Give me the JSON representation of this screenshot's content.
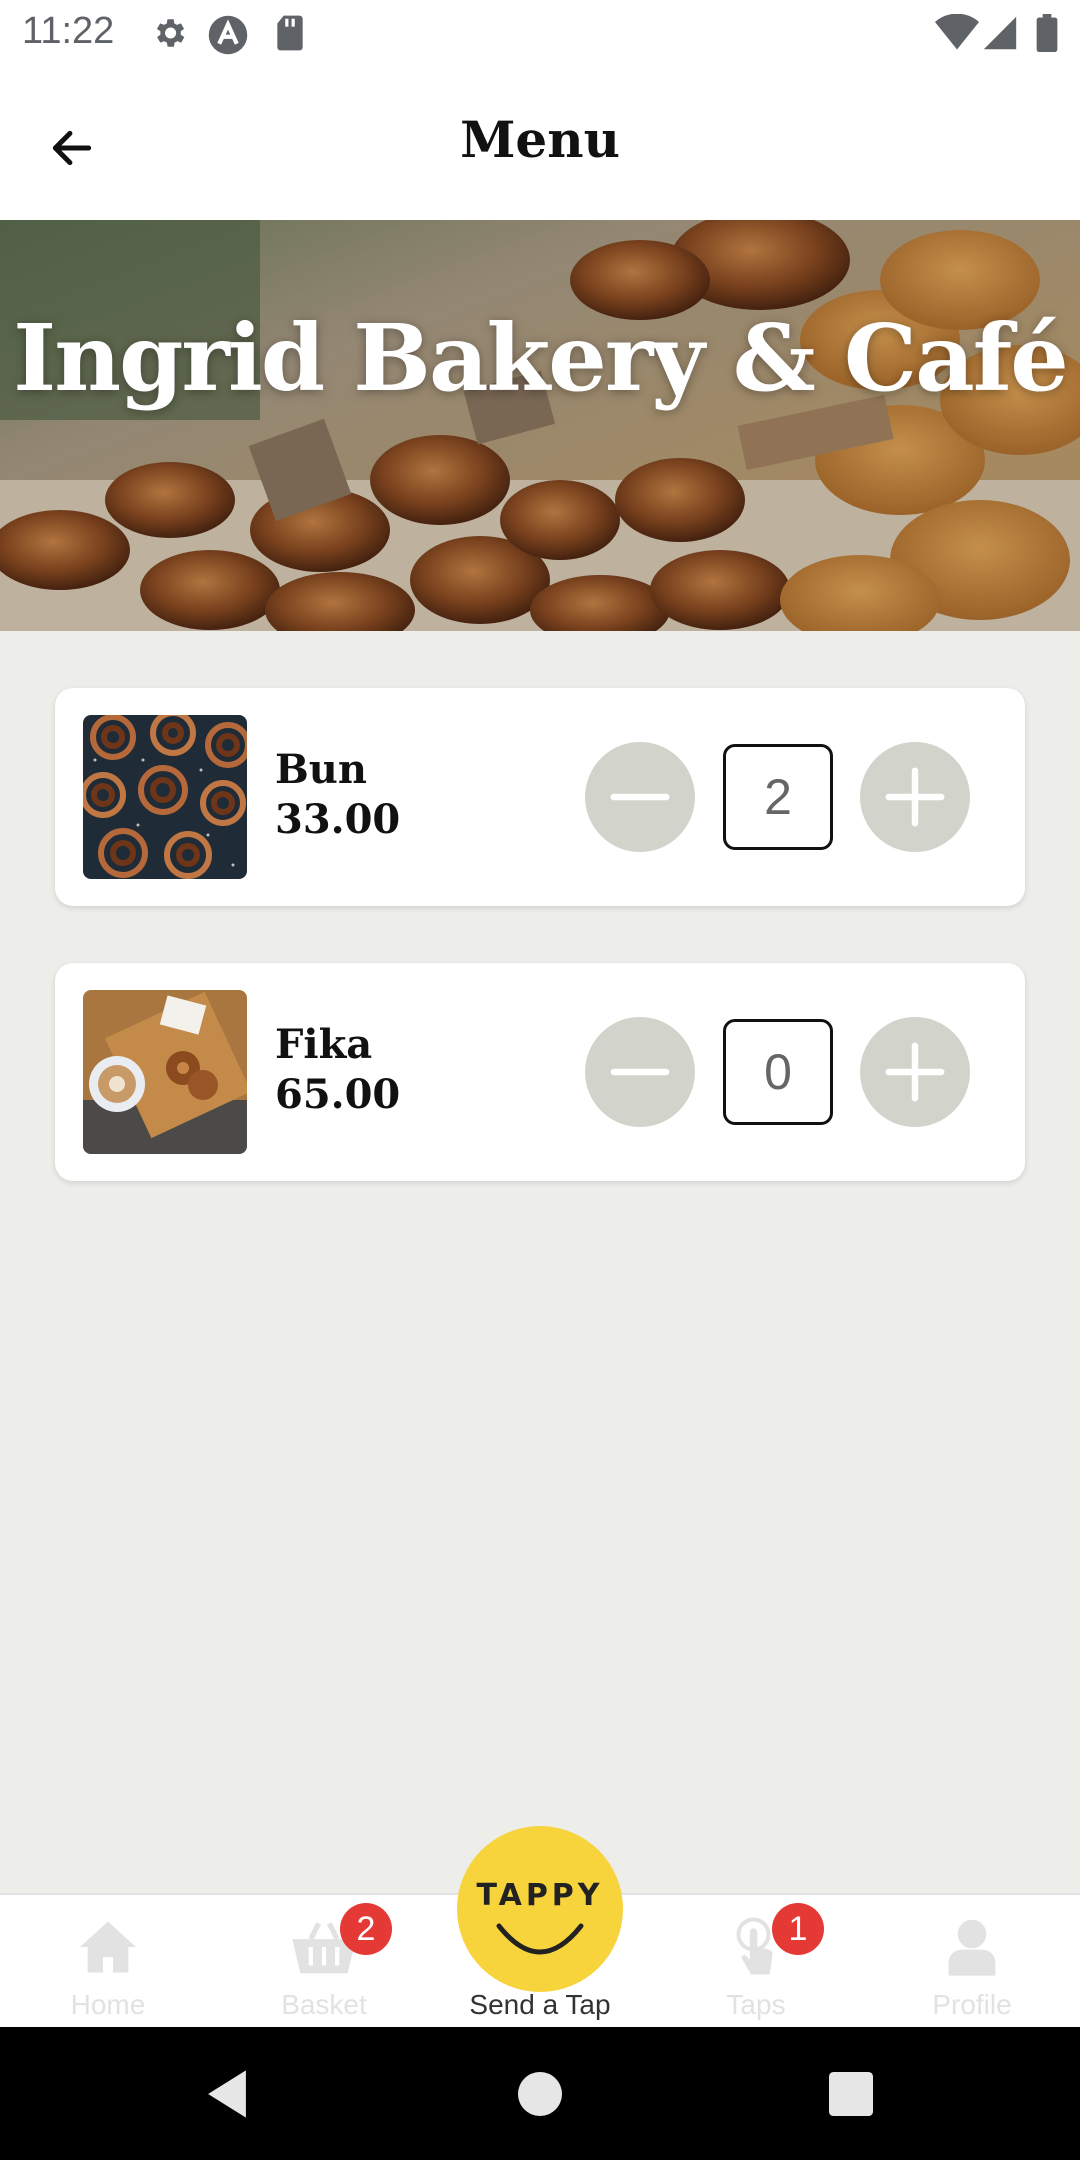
{
  "status_bar": {
    "time": "11:22"
  },
  "app_bar": {
    "title": "Menu"
  },
  "hero": {
    "title": "Ingrid Bakery & Café"
  },
  "menu_items": [
    {
      "name": "Bun",
      "price": "33.00",
      "quantity": "2"
    },
    {
      "name": "Fika",
      "price": "65.00",
      "quantity": "0"
    }
  ],
  "bottom_nav": {
    "home": {
      "label": "Home"
    },
    "basket": {
      "label": "Basket",
      "badge": "2"
    },
    "send_tap": {
      "label": "Send a Tap",
      "fab_text": "TAPPY"
    },
    "taps": {
      "label": "Taps",
      "badge": "1"
    },
    "profile": {
      "label": "Profile"
    }
  },
  "colors": {
    "background": "#ededea",
    "qty_button": "#d2d4cb",
    "fab": "#f7d33c",
    "badge": "#e53935"
  }
}
